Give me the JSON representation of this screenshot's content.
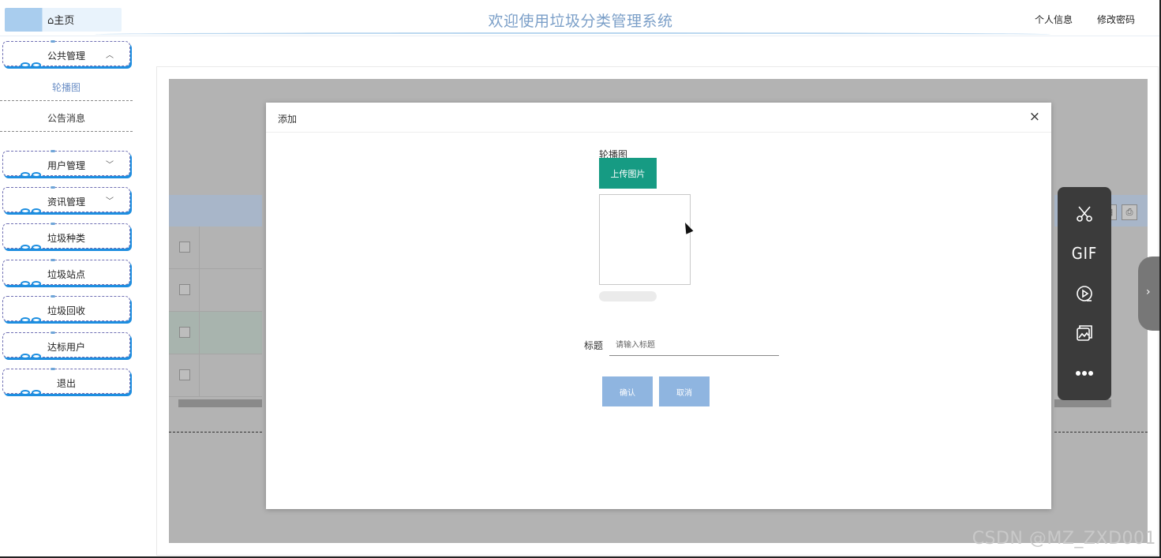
{
  "header": {
    "home_tab": "主页",
    "home_icon": "home-icon",
    "title": "欢迎使用垃圾分类管理系统",
    "profile_link": "个人信息",
    "change_password_link": "修改密码"
  },
  "sidebar": {
    "public_group": {
      "label": "公共管理",
      "expanded": true
    },
    "sub_items": [
      {
        "label": "轮播图",
        "active": true
      },
      {
        "label": "公告消息",
        "active": false
      }
    ],
    "menus": [
      {
        "label": "用户管理",
        "has_chevron": true
      },
      {
        "label": "资讯管理",
        "has_chevron": true
      },
      {
        "label": "垃圾种类",
        "has_chevron": false
      },
      {
        "label": "垃圾站点",
        "has_chevron": false
      },
      {
        "label": "垃圾回收",
        "has_chevron": false
      },
      {
        "label": "达标用户",
        "has_chevron": false
      },
      {
        "label": "退出",
        "has_chevron": false
      }
    ]
  },
  "modal": {
    "title": "添加",
    "close_symbol": "×",
    "image_field_label": "轮播图",
    "upload_button": "上传图片",
    "title_field_label": "标题",
    "title_placeholder": "请输入标题",
    "title_value": "",
    "confirm_button": "确认",
    "cancel_button": "取消"
  },
  "float_toolbar": {
    "items": [
      "scissors-icon",
      "GIF",
      "record-icon",
      "image-icon",
      "more-icon"
    ],
    "gif_label": "GIF"
  },
  "watermark": "CSDN @MZ_ZXD001",
  "colors": {
    "accent_title": "#7b9fc8",
    "upload_green": "#169b83",
    "button_blue": "#8fb5e0",
    "sidebar_shadow": "#1d8ee0"
  }
}
